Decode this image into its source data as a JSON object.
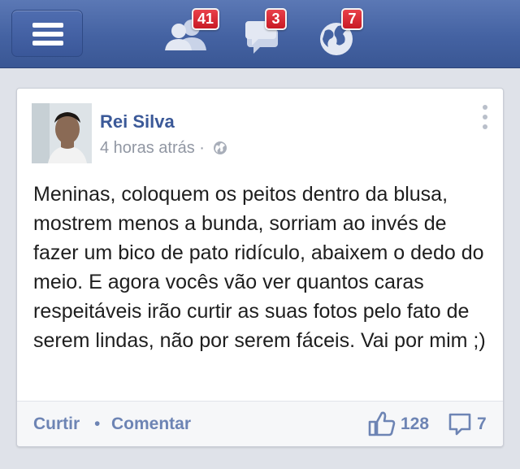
{
  "topbar": {
    "friend_requests_count": "41",
    "messages_count": "3",
    "notifications_count": "7"
  },
  "post": {
    "author": "Rei Silva",
    "timestamp": "4 horas atrás",
    "separator": "·",
    "privacy": "public",
    "text": "Meninas, coloquem os peitos dentro da blusa, mostrem menos a bunda, sorriam ao invés de fazer um bico de pato ridículo, abaixem o dedo do meio. E agora vocês vão ver quantos caras respeitáveis irão curtir as suas fotos pelo fato de serem lindas, não por serem fáceis. Vai por mim ;)",
    "like_label": "Curtir",
    "action_separator": "•",
    "comment_label": "Comentar",
    "likes_count": "128",
    "comments_count": "7"
  },
  "colors": {
    "header_blue": "#4462a2",
    "link_blue": "#3b5998",
    "footer_link": "#6d84b4",
    "badge_red": "#d42a33"
  }
}
